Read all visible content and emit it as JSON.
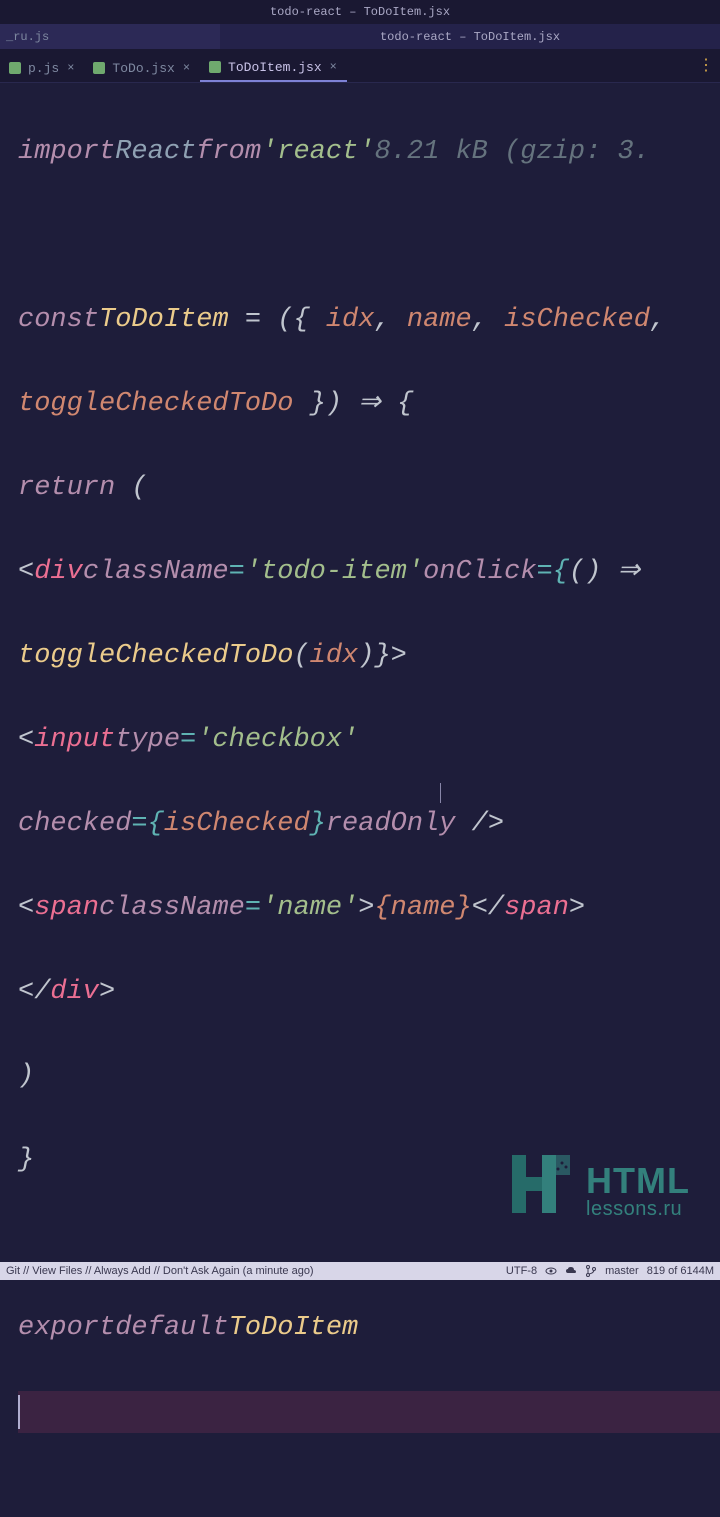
{
  "window": {
    "title": "todo-react – ToDoItem.jsx"
  },
  "topbar": {
    "left_tab": "_ru.js",
    "center_title": "todo-react – ToDoItem.jsx"
  },
  "tabs": [
    {
      "label": "p.js",
      "active": false
    },
    {
      "label": "ToDo.jsx",
      "active": false
    },
    {
      "label": "ToDoItem.jsx",
      "active": true
    }
  ],
  "bundle_hint": "8.21 kB (gzip: 3.",
  "code": {
    "l1_import": "import",
    "l1_react": "React",
    "l1_from": "from",
    "l1_mod": "'react'",
    "l3_const": "const",
    "l3_name": "ToDoItem",
    "l3_eq": " = (",
    "l3_destr_open": "{ ",
    "l3_p_idx": "idx",
    "l3_c1": ", ",
    "l3_p_name": "name",
    "l3_c2": ", ",
    "l3_p_isChecked": "isChecked",
    "l3_c3": ",",
    "l4_p_toggle": "toggleCheckedToDo",
    "l4_destr_close": " }",
    "l4_arrow": ") ⇒ {",
    "l5_return": "return",
    "l5_paren": " (",
    "l6_div_open": "<",
    "l6_div": "div",
    "l6_cn": "className",
    "l6_eq": "=",
    "l6_cn_val": "'todo-item'",
    "l6_onclick": "onClick",
    "l6_oc_val_open": "={",
    "l6_oc_arrow": "() ⇒",
    "l7_toggle_call": "toggleCheckedToDo",
    "l7_arg": "idx",
    "l7_close": ")}>",
    "l8_input_open": "<",
    "l8_input": "input",
    "l8_type": "type",
    "l8_type_val": "'checkbox'",
    "l9_checked": "checked",
    "l9_checked_val_open": "={",
    "l9_checked_val": "isChecked",
    "l9_checked_val_close": "}",
    "l9_readonly": "readOnly",
    "l9_selfclose": " />",
    "l10_span_open": "<",
    "l10_span": "span",
    "l10_cn": "className",
    "l10_cn_val": "'name'",
    "l10_gt": ">",
    "l10_brace_o": "{",
    "l10_name": "name",
    "l10_brace_c": "}",
    "l10_span_close": "</",
    "l10_span2": "span",
    "l10_gt2": ">",
    "l11_div_close": "</",
    "l11_div": "div",
    "l11_gt": ">",
    "l12_paren": ")",
    "l13_brace": "}",
    "l15_export": "export",
    "l15_default": "default",
    "l15_name": "ToDoItem"
  },
  "watermark": {
    "big": "HTML",
    "small": "lessons.ru"
  },
  "status": {
    "left": "Git // View Files // Always Add // Don't Ask Again (a minute ago)",
    "encoding": "UTF-8",
    "branch": "master",
    "memory": "819 of 6144M"
  }
}
